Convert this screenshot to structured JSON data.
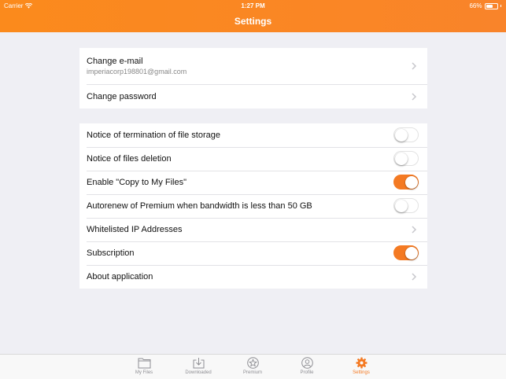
{
  "status_bar": {
    "carrier": "Carrier",
    "time": "1:27 PM",
    "battery_text": "66%",
    "battery_level": 0.66
  },
  "nav": {
    "title": "Settings"
  },
  "account": {
    "change_email_label": "Change e-mail",
    "email_value": "imperiacorp198801@gmail.com",
    "change_password_label": "Change password"
  },
  "settings": [
    {
      "label": "Notice of termination of file storage",
      "control": "toggle",
      "on": false
    },
    {
      "label": "Notice of files deletion",
      "control": "toggle",
      "on": false
    },
    {
      "label": "Enable \"Copy to My Files\"",
      "control": "toggle",
      "on": true
    },
    {
      "label": "Autorenew of Premium when bandwidth is less than 50 GB",
      "control": "toggle",
      "on": false
    },
    {
      "label": "Whitelisted IP Addresses",
      "control": "chevron"
    },
    {
      "label": "Subscription",
      "control": "toggle",
      "on": true
    },
    {
      "label": "About application",
      "control": "chevron"
    }
  ],
  "tabs": [
    {
      "label": "My Files",
      "icon": "folder-icon",
      "active": false
    },
    {
      "label": "Downloaded",
      "icon": "download-icon",
      "active": false
    },
    {
      "label": "Premium",
      "icon": "star-icon",
      "active": false
    },
    {
      "label": "Profile",
      "icon": "profile-icon",
      "active": false
    },
    {
      "label": "Settings",
      "icon": "gear-icon",
      "active": true
    }
  ],
  "colors": {
    "accent": "#f47a23",
    "nav_bg": "#fb8a1c",
    "background": "#efeff4"
  }
}
